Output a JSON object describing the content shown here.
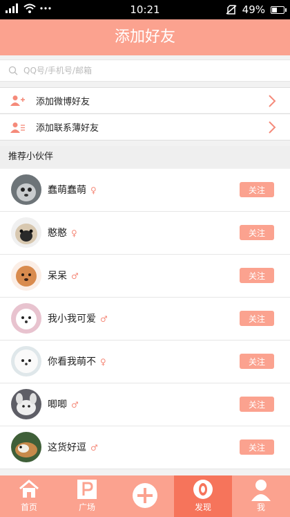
{
  "status_bar": {
    "time": "10:21",
    "battery": "49%",
    "battery_level": 0.49
  },
  "header": {
    "title": "添加好友"
  },
  "search": {
    "placeholder": "QQ号/手机号/邮箱"
  },
  "actions": [
    {
      "label": "添加微博好友"
    },
    {
      "label": "添加联系薄好友"
    }
  ],
  "section": {
    "title": "推荐小伙伴"
  },
  "friends": [
    {
      "name": "蠢萌蠢萌",
      "gender": "♀",
      "follow": "关注"
    },
    {
      "name": "憨憨",
      "gender": "♀",
      "follow": "关注"
    },
    {
      "name": "呆呆",
      "gender": "♂",
      "follow": "关注"
    },
    {
      "name": "我小我可爱",
      "gender": "♂",
      "follow": "关注"
    },
    {
      "name": "你看我萌不",
      "gender": "♀",
      "follow": "关注"
    },
    {
      "name": "唧唧",
      "gender": "♂",
      "follow": "关注"
    },
    {
      "name": "这货好逗",
      "gender": "♂",
      "follow": "关注"
    }
  ],
  "tabbar": [
    {
      "label": "首页",
      "icon": "home-icon"
    },
    {
      "label": "广场",
      "icon": "plaza-icon"
    },
    {
      "label": "",
      "icon": "plus-icon"
    },
    {
      "label": "发现",
      "icon": "discover-icon"
    },
    {
      "label": "我",
      "icon": "profile-icon"
    }
  ],
  "colors": {
    "accent": "#fba28f",
    "accent_active": "#f6745b"
  }
}
